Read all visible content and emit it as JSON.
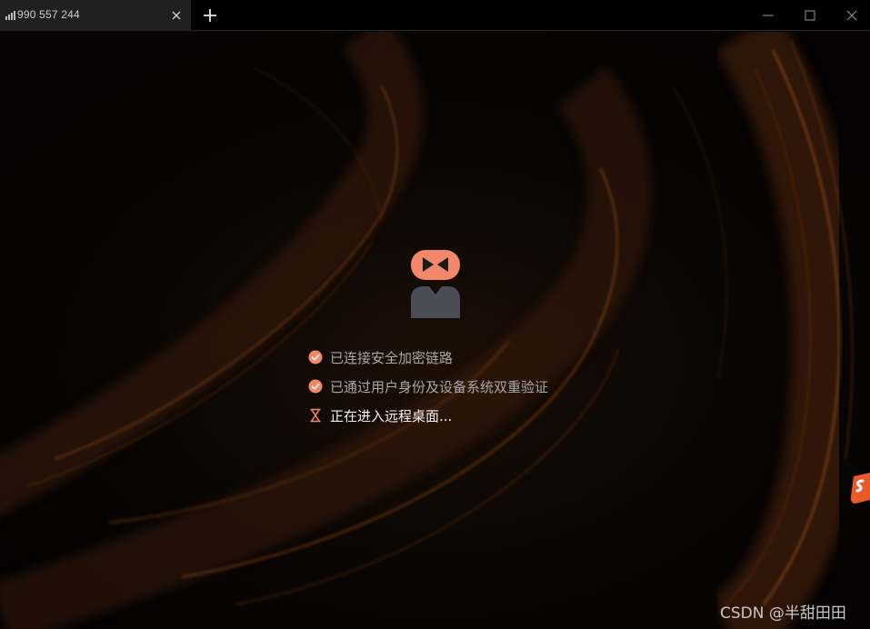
{
  "tab": {
    "title": "990 557 244",
    "icon": "signal-strength-icon"
  },
  "window_controls": {
    "minimize_icon": "minimize-icon",
    "maximize_icon": "maximize-icon",
    "close_icon": "close-icon",
    "new_tab_icon": "plus-icon"
  },
  "status": {
    "items": [
      {
        "text": "已连接安全加密链路",
        "state": "done",
        "icon": "check-circle-icon"
      },
      {
        "text": "已通过用户身份及设备系统双重验证",
        "state": "done",
        "icon": "check-circle-icon"
      },
      {
        "text": "正在进入远程桌面...",
        "state": "in-progress",
        "icon": "hourglass-icon"
      }
    ]
  },
  "watermark": {
    "text": "CSDN @半甜田田"
  },
  "colors": {
    "accent": "#f4876a",
    "avatar_body": "#4a4d55",
    "background": "#060403",
    "tab_active": "#202020"
  }
}
